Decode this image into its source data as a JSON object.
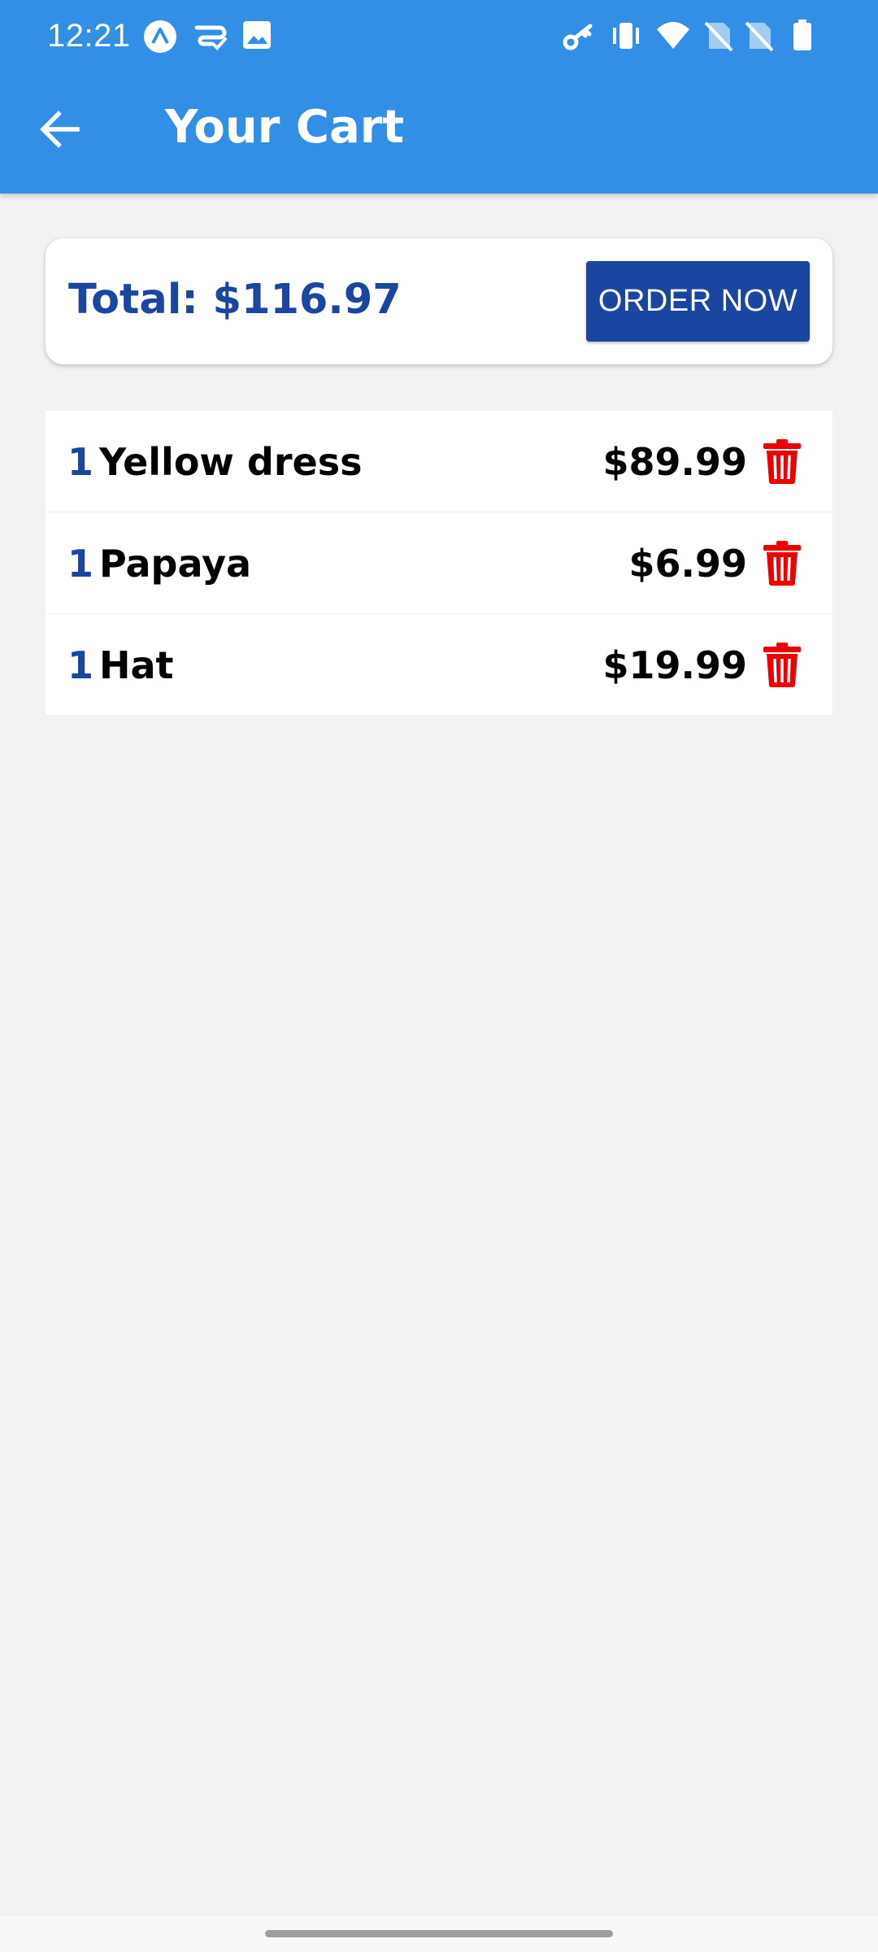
{
  "status_bar": {
    "time": "12:21",
    "left_icons": [
      "app-notification-icon",
      "cast-icon",
      "image-icon"
    ],
    "right_icons": [
      "vpn-key-icon",
      "vibrate-icon",
      "wifi-icon",
      "no-sim-icon",
      "no-sim-icon",
      "battery-icon"
    ]
  },
  "toolbar": {
    "back_icon": "arrow-back-icon",
    "title": "Your Cart",
    "background": "#338fe5"
  },
  "summary": {
    "total_label": "Total: $116.97",
    "order_button_label": "ORDER NOW",
    "accent": "#1a45a0"
  },
  "cart": {
    "items": [
      {
        "quantity": "1",
        "name": "Yellow dress",
        "price": "$89.99"
      },
      {
        "quantity": "1",
        "name": "Papaya",
        "price": "$6.99"
      },
      {
        "quantity": "1",
        "name": "Hat",
        "price": "$19.99"
      }
    ],
    "delete_icon": "trash-icon",
    "delete_color": "#ee0000"
  }
}
